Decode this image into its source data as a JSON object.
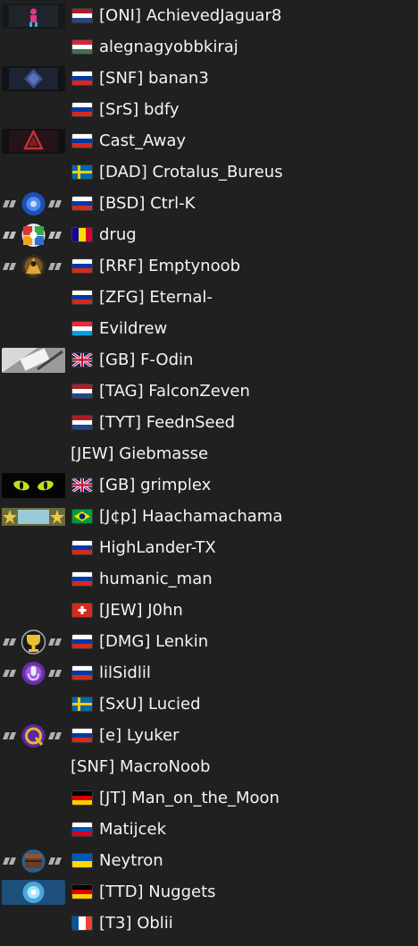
{
  "players": [
    {
      "name": "[ONI] AchievedJaguar8",
      "flag": "nl",
      "badge": "dark-figure"
    },
    {
      "name": "alegnagyobbkiraj",
      "flag": "hu",
      "badge": ""
    },
    {
      "name": "[SNF] banan3",
      "flag": "ru",
      "badge": "dark-diamond"
    },
    {
      "name": "[SrS] bdfy",
      "flag": "ru",
      "badge": ""
    },
    {
      "name": "Cast_Away",
      "flag": "ru",
      "badge": "dark-red"
    },
    {
      "name": "[DAD] Crotalus_Bureus",
      "flag": "se",
      "badge": ""
    },
    {
      "name": "[BSD] Ctrl-K",
      "flag": "ru",
      "badge": "blue-orb"
    },
    {
      "name": "drug",
      "flag": "ad",
      "badge": "colorful"
    },
    {
      "name": "[RRF] Emptynoob",
      "flag": "ru",
      "badge": "gold-orb"
    },
    {
      "name": "[ZFG] Eternal-",
      "flag": "ru",
      "badge": ""
    },
    {
      "name": "Evildrew",
      "flag": "lu",
      "badge": ""
    },
    {
      "name": "[GB] F-Odin",
      "flag": "gb",
      "badge": "grey"
    },
    {
      "name": "[TAG] FalconZeven",
      "flag": "nl",
      "badge": ""
    },
    {
      "name": "[TYT] FeednSeed",
      "flag": "nl",
      "badge": ""
    },
    {
      "name": "[JEW] Giebmasse",
      "flag": "",
      "badge": ""
    },
    {
      "name": "[GB] grimplex",
      "flag": "gb",
      "badge": "eyes"
    },
    {
      "name": "[J¢p] Haachamachama",
      "flag": "br",
      "badge": "stars"
    },
    {
      "name": "HighLander-TX",
      "flag": "ru",
      "badge": ""
    },
    {
      "name": "humanic_man",
      "flag": "ru",
      "badge": ""
    },
    {
      "name": "[JEW] J0hn",
      "flag": "ch",
      "badge": ""
    },
    {
      "name": "[DMG] Lenkin",
      "flag": "ru",
      "badge": "gold-trophy"
    },
    {
      "name": "lilSidlil",
      "flag": "ru",
      "badge": "purple-mic"
    },
    {
      "name": "[SxU] Lucied",
      "flag": "se",
      "badge": ""
    },
    {
      "name": "[e] Lyuker",
      "flag": "ru",
      "badge": "purple-gold"
    },
    {
      "name": "[SNF] MacroNoob",
      "flag": "",
      "badge": ""
    },
    {
      "name": "[JT] Man_on_the_Moon",
      "flag": "de",
      "badge": ""
    },
    {
      "name": "Matijcek",
      "flag": "si",
      "badge": ""
    },
    {
      "name": "Neytron",
      "flag": "ua",
      "badge": "brown-orb"
    },
    {
      "name": "[TTD] Nuggets",
      "flag": "de",
      "badge": "blue-light"
    },
    {
      "name": "[T3] Oblii",
      "flag": "fr",
      "badge": ""
    }
  ]
}
